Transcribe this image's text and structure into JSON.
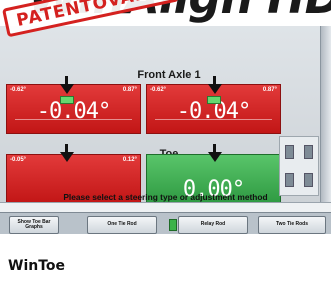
{
  "brand": {
    "title": "WinAlign HD"
  },
  "stamp": {
    "text": "PATENTOVÁNO"
  },
  "screen": {
    "front_axle_title": "Front Axle 1",
    "toe_title": "Toe",
    "gauges": [
      {
        "id": "left-camber",
        "color": "red",
        "low": "-0.62°",
        "high": "0.87°",
        "value": "-0.04°"
      },
      {
        "id": "right-camber",
        "color": "red",
        "low": "-0.62°",
        "high": "0.87°",
        "value": "-0.04°"
      },
      {
        "id": "left-toe",
        "color": "red",
        "low": "-0.05°",
        "high": "0.12°",
        "value": ""
      },
      {
        "id": "right-toe",
        "color": "green",
        "low": "",
        "high": "",
        "value": "0.00°"
      }
    ],
    "message": "Please select a steering type or adjustment method",
    "buttons": [
      {
        "label": "Show Toe Bar Graphs"
      },
      {
        "label": "One Tie Rod"
      },
      {
        "label": "Relay Rod"
      },
      {
        "label": "Two Tie Rods"
      }
    ]
  },
  "caption": "WinToe",
  "colors": {
    "red": "#d42020",
    "green": "#3bb24b",
    "stamp": "#d4211f"
  }
}
